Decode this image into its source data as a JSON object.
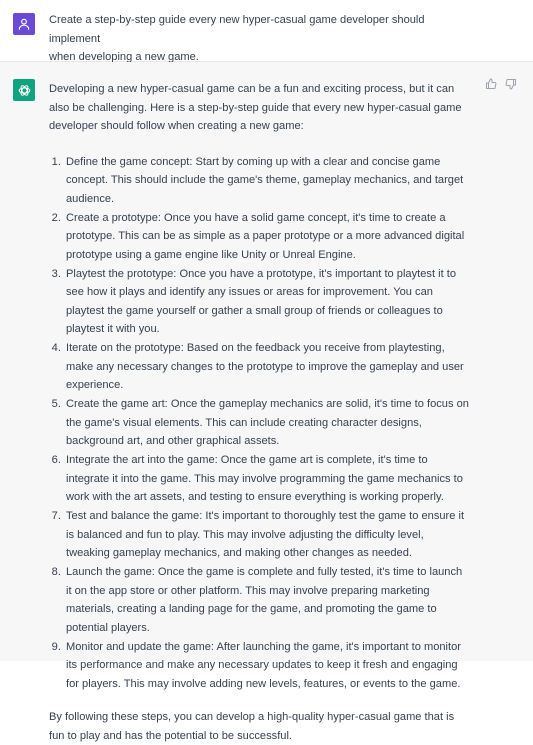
{
  "user_message": {
    "text": "Create a step-by-step guide every new hyper-casual game developer should implement\nwhen developing a new game."
  },
  "assistant_message": {
    "intro": "Developing a new hyper-casual game can be a fun and exciting process, but it can also be challenging. Here is a step-by-step guide that every new hyper-casual game developer should follow when creating a new game:",
    "steps": [
      "Define the game concept: Start by coming up with a clear and concise game concept. This should include the game's theme, gameplay mechanics, and target audience.",
      "Create a prototype: Once you have a solid game concept, it's time to create a prototype. This can be as simple as a paper prototype or a more advanced digital prototype using a game engine like Unity or Unreal Engine.",
      "Playtest the prototype: Once you have a prototype, it's important to playtest it to see how it plays and identify any issues or areas for improvement. You can playtest the game yourself or gather a small group of friends or colleagues to playtest it with you.",
      "Iterate on the prototype: Based on the feedback you receive from playtesting, make any necessary changes to the prototype to improve the gameplay and user experience.",
      "Create the game art: Once the gameplay mechanics are solid, it's time to focus on the game's visual elements. This can include creating character designs, background art, and other graphical assets.",
      "Integrate the art into the game: Once the game art is complete, it's time to integrate it into the game. This may involve programming the game mechanics to work with the art assets, and testing to ensure everything is working properly.",
      "Test and balance the game: It's important to thoroughly test the game to ensure it is balanced and fun to play. This may involve adjusting the difficulty level, tweaking gameplay mechanics, and making other changes as needed.",
      "Launch the game: Once the game is complete and fully tested, it's time to launch it on the app store or other platform. This may involve preparing marketing materials, creating a landing page for the game, and promoting the game to potential players.",
      "Monitor and update the game: After launching the game, it's important to monitor its performance and make any necessary updates to keep it fresh and engaging for players. This may involve adding new levels, features, or events to the game."
    ],
    "conclusion": "By following these steps, you can develop a high-quality hyper-casual game that is fun to play and has the potential to be successful."
  },
  "icons": {
    "user_avatar": "user-icon",
    "assistant_avatar": "openai-logo-icon",
    "thumbs_up": "thumbs-up-icon",
    "thumbs_down": "thumbs-down-icon"
  },
  "colors": {
    "user_avatar_bg": "#6c4ad6",
    "assistant_avatar_bg": "#10a37f",
    "assistant_row_bg": "#f7f7f8",
    "text": "#374151"
  }
}
